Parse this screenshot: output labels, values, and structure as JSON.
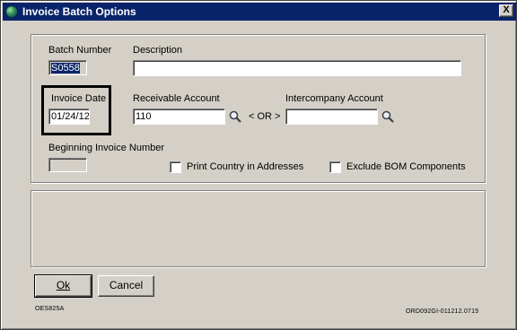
{
  "window": {
    "title": "Invoice Batch Options",
    "close_glyph": "X"
  },
  "batch_number": {
    "label": "Batch Number",
    "value": "S0558"
  },
  "description": {
    "label": "Description",
    "value": ""
  },
  "invoice_date": {
    "label": "Invoice Date",
    "value": "01/24/12"
  },
  "receivable_account": {
    "label": "Receivable Account",
    "value": "110",
    "lookup_icon": "magnifier-icon"
  },
  "or_separator": "< OR >",
  "intercompany_account": {
    "label": "Intercompany Account",
    "value": "",
    "lookup_icon": "magnifier-icon"
  },
  "beginning_invoice_number": {
    "label": "Beginning Invoice Number",
    "value": ""
  },
  "print_country": {
    "label": "Print Country in Addresses",
    "checked": false
  },
  "exclude_bom": {
    "label": "Exclude BOM Components",
    "checked": false
  },
  "buttons": {
    "ok": "Ok",
    "cancel": "Cancel"
  },
  "footer": {
    "left_code": "OES825A",
    "right_code": "ORD092GI-011212.0715"
  }
}
